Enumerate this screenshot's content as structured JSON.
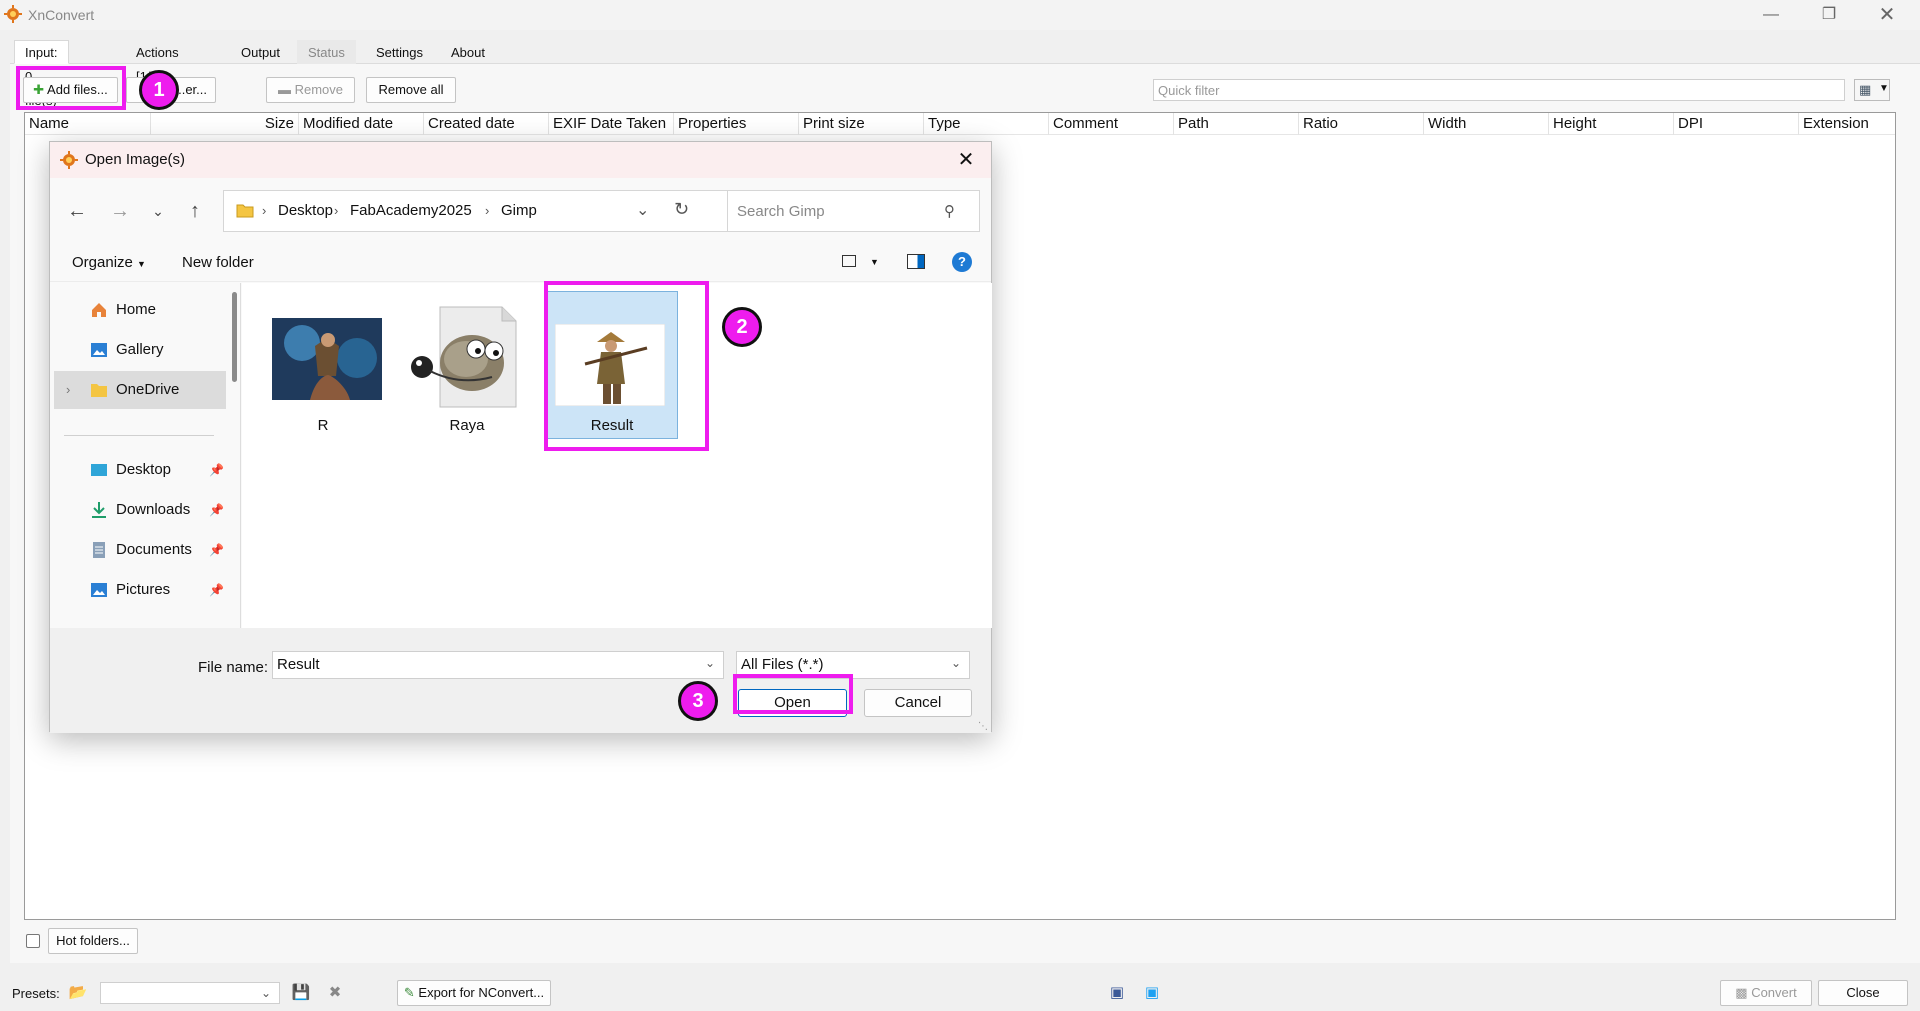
{
  "app": {
    "title": "XnConvert",
    "window_controls": [
      "minimize-icon",
      "restore-icon",
      "close-icon"
    ]
  },
  "tabs": [
    {
      "label": "Input: 0 file(s)",
      "state": "active"
    },
    {
      "label": "Actions [1/1]",
      "state": "normal"
    },
    {
      "label": "Output",
      "state": "normal"
    },
    {
      "label": "Status",
      "state": "disabled"
    },
    {
      "label": "Settings",
      "state": "normal"
    },
    {
      "label": "About",
      "state": "normal"
    }
  ],
  "input_toolbar": {
    "add_files": "Add files...",
    "add_folder_partial": "...er...",
    "remove": "Remove",
    "remove_all": "Remove all",
    "quick_filter_placeholder": "Quick filter"
  },
  "file_columns": [
    "Name",
    "Size",
    "Modified date",
    "Created date",
    "EXIF Date Taken",
    "Properties",
    "Print size",
    "Type",
    "Comment",
    "Path",
    "Ratio",
    "Width",
    "Height",
    "DPI",
    "Extension"
  ],
  "bottom": {
    "hot_folders": "Hot folders...",
    "presets_label": "Presets:",
    "export_nconvert": "Export for NConvert...",
    "convert": "Convert",
    "close": "Close"
  },
  "dialog": {
    "title": "Open Image(s)",
    "breadcrumb": [
      "Desktop",
      "FabAcademy2025",
      "Gimp"
    ],
    "search_placeholder": "Search Gimp",
    "organize": "Organize",
    "new_folder": "New folder",
    "nav_items": [
      {
        "label": "Home",
        "icon": "home-icon",
        "pinned": false,
        "selected": false
      },
      {
        "label": "Gallery",
        "icon": "gallery-icon",
        "pinned": false,
        "selected": false
      },
      {
        "label": "OneDrive",
        "icon": "folder-icon",
        "pinned": false,
        "selected": true
      },
      {
        "label": "Desktop",
        "icon": "desktop-icon",
        "pinned": true,
        "selected": false
      },
      {
        "label": "Downloads",
        "icon": "download-icon",
        "pinned": true,
        "selected": false
      },
      {
        "label": "Documents",
        "icon": "document-icon",
        "pinned": true,
        "selected": false
      },
      {
        "label": "Pictures",
        "icon": "pictures-icon",
        "pinned": true,
        "selected": false
      }
    ],
    "files": [
      {
        "name": "R",
        "icon": "image-thumbnail-icon",
        "selected": false
      },
      {
        "name": "Raya",
        "icon": "gimp-file-icon",
        "selected": false
      },
      {
        "name": "Result",
        "icon": "image-thumbnail-icon",
        "selected": true
      }
    ],
    "file_name_label": "File name:",
    "file_name_value": "Result",
    "file_type": "All Files (*.*)",
    "open": "Open",
    "cancel": "Cancel"
  },
  "callouts": [
    "1",
    "2",
    "3"
  ],
  "colors": {
    "callout": "#ee1cee",
    "selection": "#cce4f7",
    "accent": "#0067c0"
  }
}
